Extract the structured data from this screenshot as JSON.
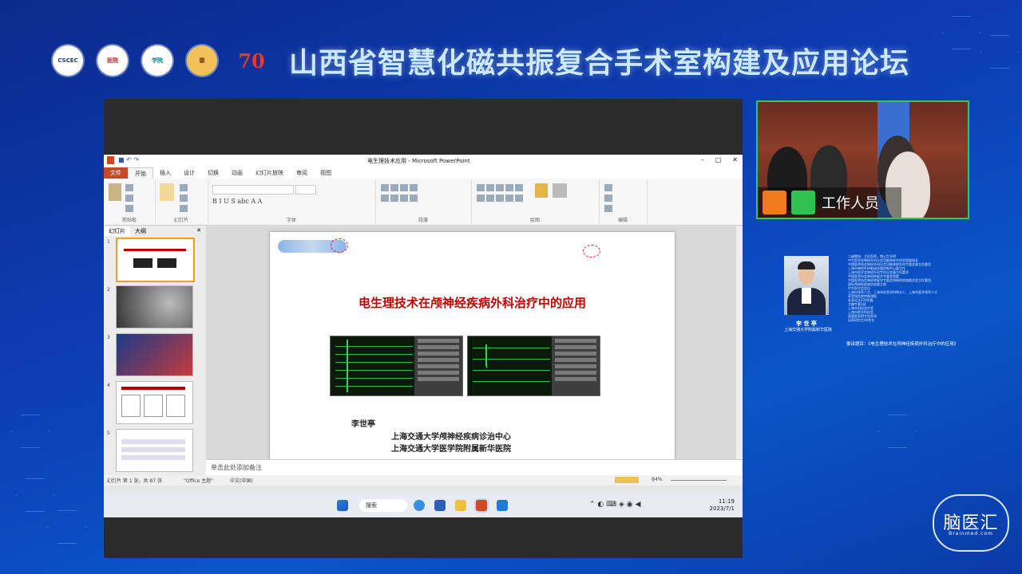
{
  "header": {
    "logos": [
      "CSCEC",
      "医院",
      "学院",
      "徽",
      "70"
    ],
    "title": "山西省智慧化磁共振复合手术室构建及应用论坛"
  },
  "powerpoint": {
    "window_title": "电生理技术应用 - Microsoft PowerPoint",
    "tabs": [
      "文件",
      "开始",
      "插入",
      "设计",
      "切换",
      "动画",
      "幻灯片放映",
      "审阅",
      "视图"
    ],
    "ribbon_groups": [
      "剪贴板",
      "幻灯片",
      "字体",
      "段落",
      "绘图",
      "编辑"
    ],
    "panel_tabs": [
      "幻灯片",
      "大纲"
    ],
    "thumbnail_numbers": [
      "1",
      "2",
      "3",
      "4",
      "5"
    ],
    "slide": {
      "title": "电生理技术在颅神经疾病外科治疗中的应用",
      "author": "李世亭",
      "affiliation_1": "上海交通大学颅神经疾病诊治中心",
      "affiliation_2": "上海交通大学医学院附属新华医院"
    },
    "notes_placeholder": "单击此处添加备注",
    "status": {
      "slide_info": "幻灯片 第 1 张，共 87 张",
      "theme": "\"Office 主题\"",
      "language": "中文(中国)",
      "zoom": "84%"
    }
  },
  "taskbar": {
    "search": "搜索",
    "time": "11:19",
    "date": "2023/7/1"
  },
  "webcam": {
    "label": "工作人员"
  },
  "speaker": {
    "name": "李 世 亭",
    "affiliation": "上海交通大学附属新华医院",
    "bio_lines": [
      "二级教授、主任医师、博士生导师",
      "中华医学会神经外科分会功能神经外科学组副组长",
      "中国医师协会神经外科分会功能神经外科专委会副主任委员",
      "上海市神经外科临床质量控制中心副主任",
      "上海市医学会神经外科专科分会副主任委员",
      "中国医师协会神经修复学专委会常委",
      "中国医师协会神经修复学专委会颅神经疾病委员会主任委员",
      "国际颅神经疾病协会副主席",
      "中华医学会会员",
      "上海市领军人才、上海市优秀学科带头人、上海市医学领军人才",
      "享受国务院特殊津贴",
      "发表论文200余篇",
      "主编专著5部",
      "上海市科技进步奖",
      "上海市医学科技奖",
      "获国家发明专利多项",
      "培养研究生50余名"
    ],
    "topic": "报讲题目：《电生理技术在颅神经疾病外科治疗中的应用》"
  },
  "watermark": {
    "text": "脑医汇",
    "sub": "Brainmed.com"
  },
  "colors": {
    "background": "#0d3fb8",
    "title_text": "#cde9ff",
    "slide_title": "#c00000",
    "webcam_border": "#2ccc55",
    "ppt_file_tab": "#c64a26"
  }
}
